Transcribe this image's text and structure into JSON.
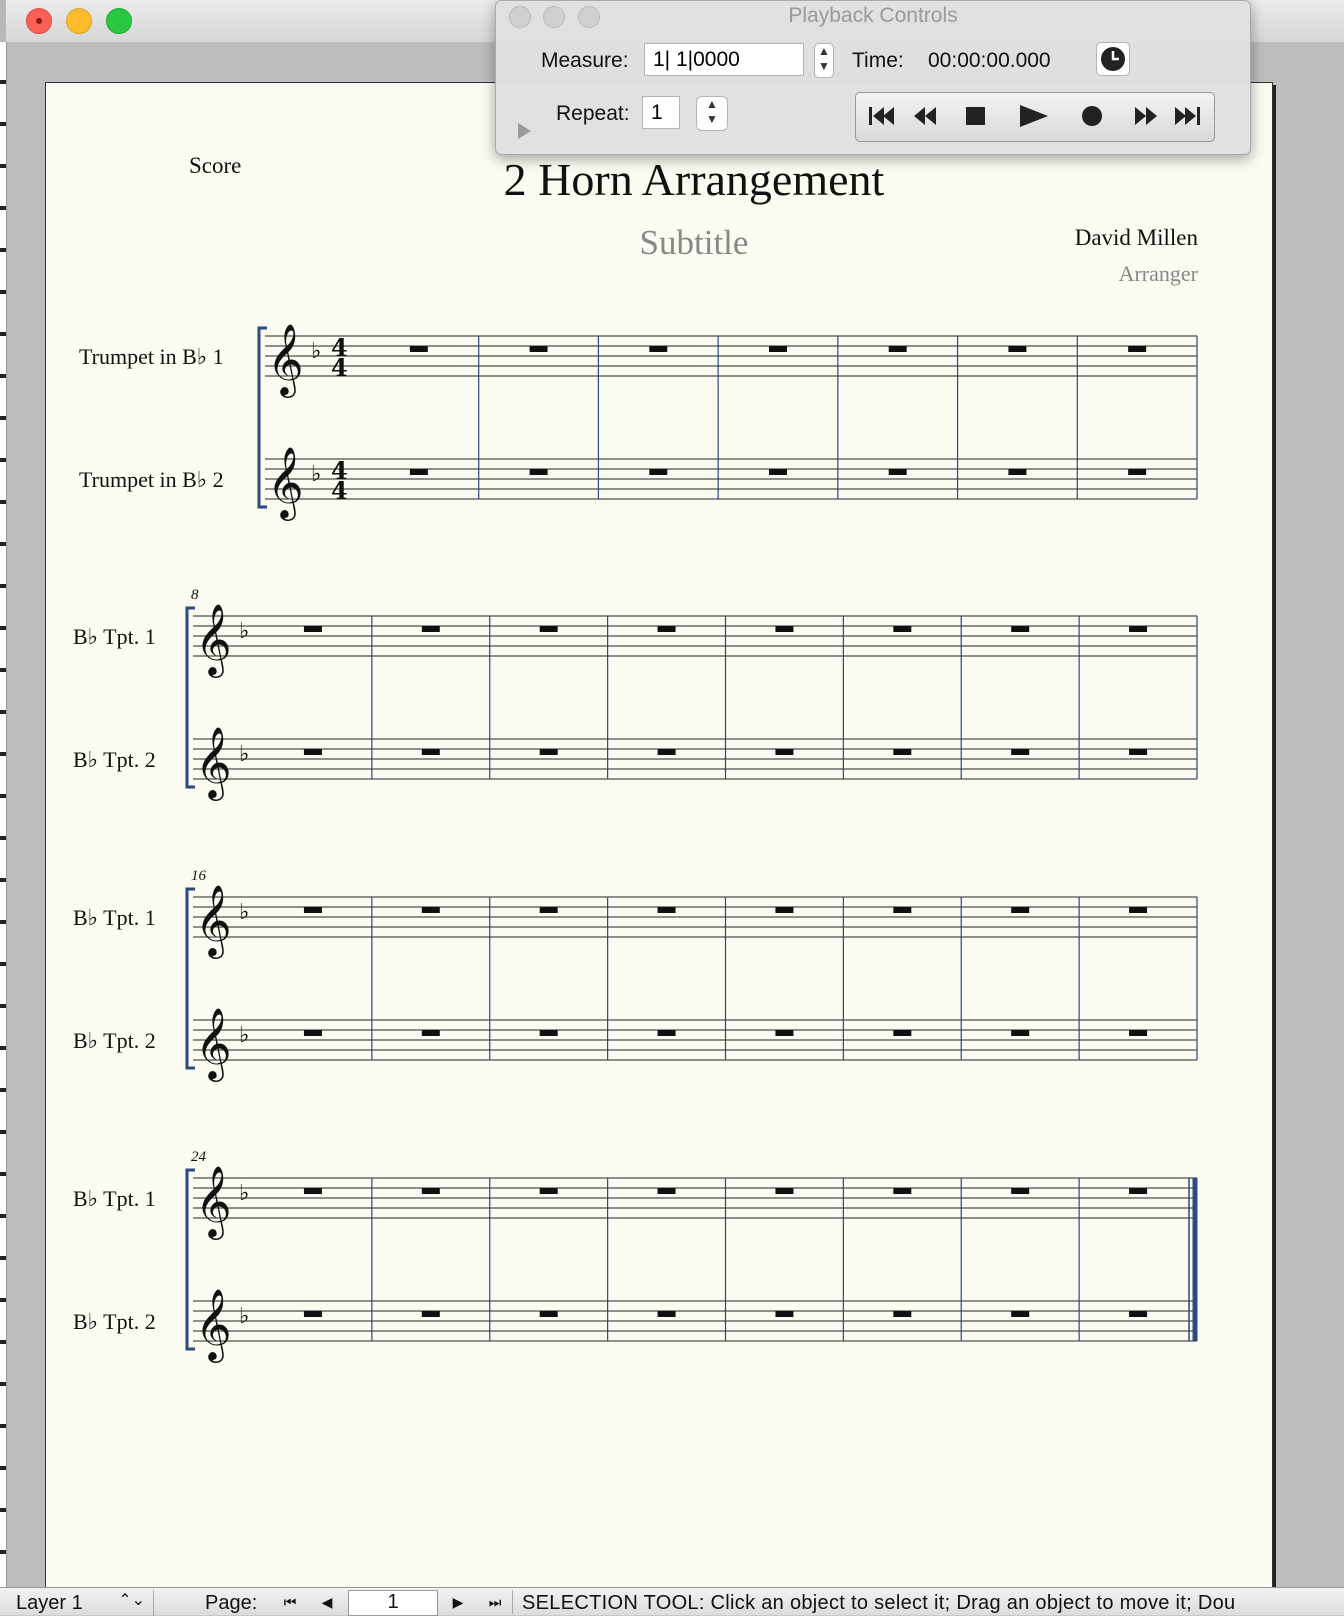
{
  "score": {
    "label": "Score",
    "title": "2 Horn Arrangement",
    "subtitle": "Subtitle",
    "composer": "David Millen",
    "arranger": "Arranger",
    "key_signature": "F major (1 flat)",
    "time_signature": "4/4",
    "systems": [
      {
        "start_measure_number": "",
        "measures": 7,
        "staff_names": [
          "Trumpet in B♭ 1",
          "Trumpet in B♭ 2"
        ]
      },
      {
        "start_measure_number": "8",
        "measures": 8,
        "staff_names": [
          "B♭ Tpt. 1",
          "B♭ Tpt. 2"
        ]
      },
      {
        "start_measure_number": "16",
        "measures": 8,
        "staff_names": [
          "B♭ Tpt. 1",
          "B♭ Tpt. 2"
        ]
      },
      {
        "start_measure_number": "24",
        "measures": 8,
        "staff_names": [
          "B♭ Tpt. 1",
          "B♭ Tpt. 2"
        ],
        "final_barline": true
      }
    ]
  },
  "playback": {
    "window_title": "Playback Controls",
    "measure_label": "Measure:",
    "measure_value": "1| 1|0000",
    "time_label": "Time:",
    "time_value": "00:00:00.000",
    "repeat_label": "Repeat:",
    "repeat_value": "1",
    "transport_icons": [
      "skip-to-start-icon",
      "rewind-icon",
      "stop-icon",
      "play-icon",
      "record-icon",
      "fast-forward-icon",
      "skip-to-end-icon"
    ]
  },
  "status_bar": {
    "layer": "Layer 1",
    "page_label": "Page:",
    "page_value": "1",
    "message": "SELECTION TOOL: Click an object to select it; Drag an object to move it; Dou"
  },
  "colors": {
    "paper": "#fbfbf2",
    "barline_blue": "#2b4a80",
    "close": "#fc5f57",
    "minimize": "#fdbc2e",
    "maximize": "#29c840"
  }
}
